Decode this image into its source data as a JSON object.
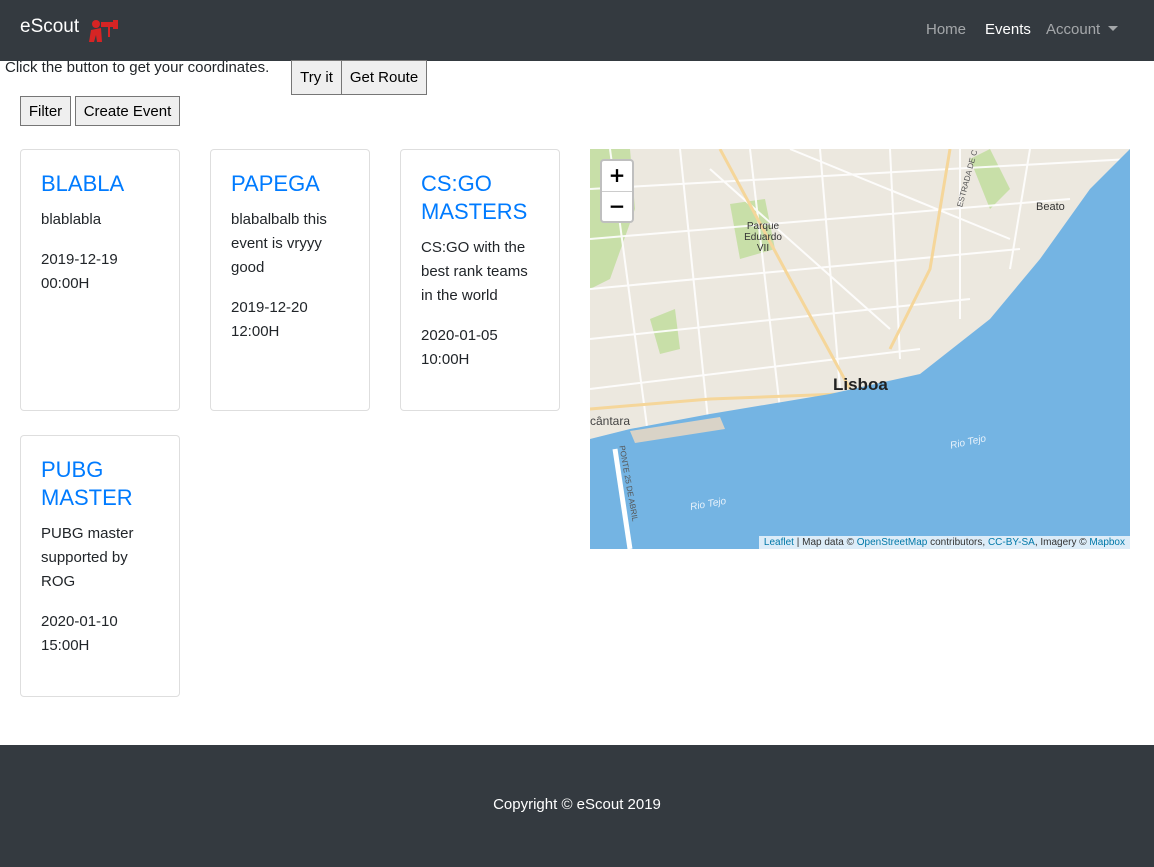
{
  "nav": {
    "brand": "eScout",
    "brand_icon": "binoculars-person-icon",
    "links": [
      "Home",
      "Events",
      "Account"
    ],
    "active": "Events"
  },
  "geo": {
    "prompt": "Click the button to get your coordinates.",
    "try_label": "Try it",
    "route_label": "Get Route"
  },
  "toolbar": {
    "filter_label": "Filter",
    "create_label": "Create Event"
  },
  "events": [
    {
      "title": "BLABLA",
      "description": "blablabla",
      "datetime": "2019-12-19 00:00H"
    },
    {
      "title": "PAPEGA",
      "description": "blabalbalb this event is vryyy good",
      "datetime": "2019-12-20 12:00H"
    },
    {
      "title": "CS:GO MASTERS",
      "description": "CS:GO with the best rank teams in the world",
      "datetime": "2020-01-05 10:00H"
    },
    {
      "title": "PUBG MASTER",
      "description": "PUBG master supported by ROG",
      "datetime": "2020-01-10 15:00H"
    }
  ],
  "map": {
    "zoom_in": "+",
    "zoom_out": "−",
    "labels": {
      "city": "Lisboa",
      "park": "Parque Eduardo VII",
      "beato": "Beato",
      "river1": "Rio Tejo",
      "river2": "Rio Tejo",
      "alcantara": "cântara",
      "bridge": "PONTE 25 DE ABRIL",
      "road": "ESTRADA DE C"
    },
    "attribution": {
      "leaflet": "Leaflet",
      "sep1": " | Map data © ",
      "osm": "OpenStreetMap",
      "contrib": " contributors, ",
      "license": "CC-BY-SA",
      "imagery": ", Imagery © ",
      "mapbox": "Mapbox"
    },
    "colors": {
      "land": "#ece8df",
      "water": "#74b4e3",
      "park": "#c8dfa8"
    }
  },
  "footer": {
    "copyright": "Copyright © eScout 2019"
  },
  "colors": {
    "navbar": "#343a40",
    "accent": "#007bff",
    "brand_icon": "#d62424"
  }
}
